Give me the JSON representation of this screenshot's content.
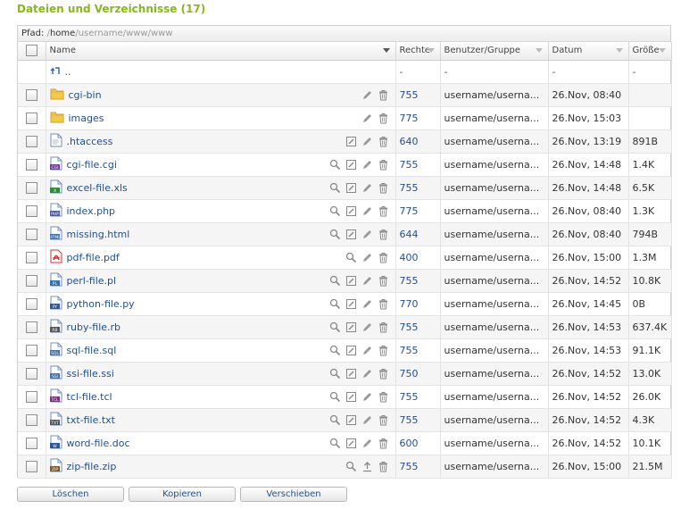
{
  "title": "Dateien und Verzeichnisse (17)",
  "path": {
    "label": "Pfad:",
    "seg1": "home",
    "seg2": "username",
    "seg3": "www",
    "seg4": "www"
  },
  "columns": {
    "name": "Name",
    "perms": "Rechte",
    "owner": "Benutzer/Gruppe",
    "date": "Datum",
    "size": "Größe"
  },
  "parent": {
    "name": "..",
    "perms": "-",
    "owner": "-",
    "date": "-",
    "size": "-"
  },
  "rows": [
    {
      "name": "cgi-bin",
      "icon": "folder-icon",
      "perms": "755",
      "owner": "username/userna...",
      "date": "26.Nov, 08:40",
      "size": ""
    },
    {
      "name": "images",
      "icon": "folder-icon",
      "perms": "775",
      "owner": "username/userna...",
      "date": "26.Nov, 15:03",
      "size": ""
    },
    {
      "name": ".htaccess",
      "icon": "text-file-icon",
      "perms": "640",
      "owner": "username/userna...",
      "date": "26.Nov, 13:19",
      "size": "891B"
    },
    {
      "name": "cgi-file.cgi",
      "icon": "cgi-file-icon",
      "perms": "755",
      "owner": "username/userna...",
      "date": "26.Nov, 14:48",
      "size": "1.4K"
    },
    {
      "name": "excel-file.xls",
      "icon": "excel-file-icon",
      "perms": "755",
      "owner": "username/userna...",
      "date": "26.Nov, 14:48",
      "size": "6.5K"
    },
    {
      "name": "index.php",
      "icon": "php-file-icon",
      "perms": "775",
      "owner": "username/userna...",
      "date": "26.Nov, 08:40",
      "size": "1.3K"
    },
    {
      "name": "missing.html",
      "icon": "html-file-icon",
      "perms": "644",
      "owner": "username/userna...",
      "date": "26.Nov, 08:40",
      "size": "794B"
    },
    {
      "name": "pdf-file.pdf",
      "icon": "pdf-file-icon",
      "perms": "400",
      "owner": "username/userna...",
      "date": "26.Nov, 15:00",
      "size": "1.3M"
    },
    {
      "name": "perl-file.pl",
      "icon": "perl-file-icon",
      "perms": "755",
      "owner": "username/userna...",
      "date": "26.Nov, 14:52",
      "size": "10.8K"
    },
    {
      "name": "python-file.py",
      "icon": "python-file-icon",
      "perms": "770",
      "owner": "username/userna...",
      "date": "26.Nov, 14:45",
      "size": "0B"
    },
    {
      "name": "ruby-file.rb",
      "icon": "ruby-file-icon",
      "perms": "755",
      "owner": "username/userna...",
      "date": "26.Nov, 14:53",
      "size": "637.4K"
    },
    {
      "name": "sql-file.sql",
      "icon": "sql-file-icon",
      "perms": "755",
      "owner": "username/userna...",
      "date": "26.Nov, 14:53",
      "size": "91.1K"
    },
    {
      "name": "ssi-file.ssi",
      "icon": "ssi-file-icon",
      "perms": "750",
      "owner": "username/userna...",
      "date": "26.Nov, 14:52",
      "size": "13.0K"
    },
    {
      "name": "tcl-file.tcl",
      "icon": "tcl-file-icon",
      "perms": "755",
      "owner": "username/userna...",
      "date": "26.Nov, 14:52",
      "size": "26.0K"
    },
    {
      "name": "txt-file.txt",
      "icon": "txt-file-icon",
      "perms": "755",
      "owner": "username/userna...",
      "date": "26.Nov, 14:52",
      "size": "4.3K"
    },
    {
      "name": "word-file.doc",
      "icon": "word-file-icon",
      "perms": "600",
      "owner": "username/userna...",
      "date": "26.Nov, 14:52",
      "size": "10.1K"
    },
    {
      "name": "zip-file.zip",
      "icon": "zip-file-icon",
      "perms": "755",
      "owner": "username/userna...",
      "date": "26.Nov, 15:00",
      "size": "21.5M"
    }
  ],
  "buttons": {
    "delete": "Löschen",
    "copy": "Kopieren",
    "move": "Verschieben"
  },
  "colors": {
    "accent": "#8ab61e",
    "link": "#1f4f8f"
  }
}
